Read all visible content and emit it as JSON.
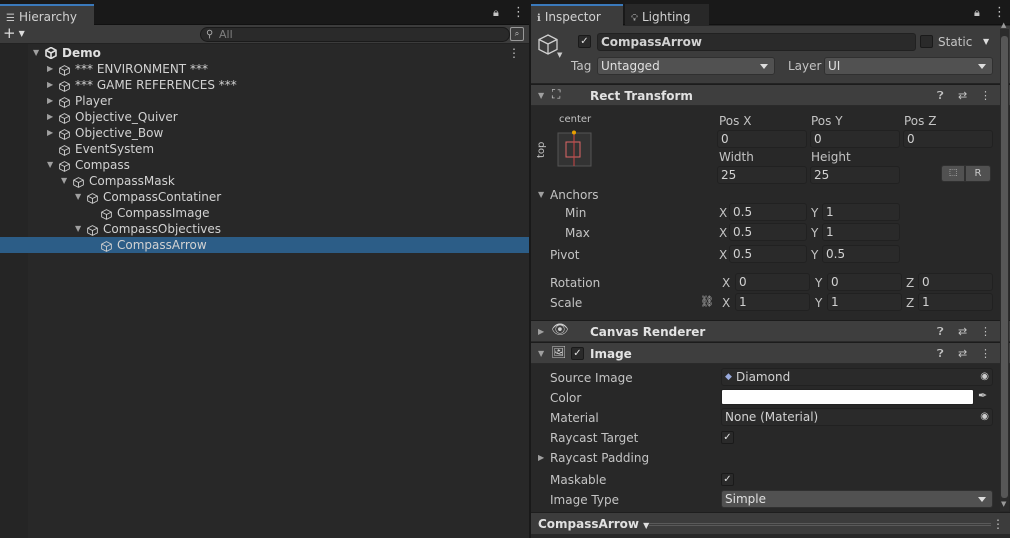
{
  "hierarchy": {
    "tab_label": "Hierarchy",
    "add_label": "+",
    "search_placeholder": "All",
    "scene": "Demo",
    "items": [
      {
        "label": "*** ENVIRONMENT ***",
        "depth": 1,
        "expandable": true,
        "expanded": false,
        "selected": false
      },
      {
        "label": "*** GAME REFERENCES ***",
        "depth": 1,
        "expandable": true,
        "expanded": false,
        "selected": false
      },
      {
        "label": "Player",
        "depth": 1,
        "expandable": true,
        "expanded": false,
        "selected": false
      },
      {
        "label": "Objective_Quiver",
        "depth": 1,
        "expandable": true,
        "expanded": false,
        "selected": false
      },
      {
        "label": "Objective_Bow",
        "depth": 1,
        "expandable": true,
        "expanded": false,
        "selected": false
      },
      {
        "label": "EventSystem",
        "depth": 1,
        "expandable": false,
        "expanded": false,
        "selected": false
      },
      {
        "label": "Compass",
        "depth": 1,
        "expandable": true,
        "expanded": true,
        "selected": false
      },
      {
        "label": "CompassMask",
        "depth": 2,
        "expandable": true,
        "expanded": true,
        "selected": false
      },
      {
        "label": "CompassContatiner",
        "depth": 3,
        "expandable": true,
        "expanded": true,
        "selected": false
      },
      {
        "label": "CompassImage",
        "depth": 4,
        "expandable": false,
        "expanded": false,
        "selected": false
      },
      {
        "label": "CompassObjectives",
        "depth": 3,
        "expandable": true,
        "expanded": true,
        "selected": false
      },
      {
        "label": "CompassArrow",
        "depth": 4,
        "expandable": false,
        "expanded": false,
        "selected": true
      }
    ]
  },
  "inspector": {
    "tabs": [
      {
        "label": "Inspector",
        "icon": "info-icon"
      },
      {
        "label": "Lighting",
        "icon": "bulb-icon"
      }
    ],
    "object_name": "CompassArrow",
    "static_label": "Static",
    "tag_label": "Tag",
    "tag_value": "Untagged",
    "layer_label": "Layer",
    "layer_value": "UI",
    "rect_transform": {
      "title": "Rect Transform",
      "anchor_preset_h": "center",
      "anchor_preset_v": "top",
      "pos_x_label": "Pos X",
      "pos_y_label": "Pos Y",
      "pos_z_label": "Pos Z",
      "pos_x": "0",
      "pos_y": "0",
      "pos_z": "0",
      "width_label": "Width",
      "height_label": "Height",
      "width": "25",
      "height": "25",
      "r_label": "R",
      "anchors_label": "Anchors",
      "min_label": "Min",
      "max_label": "Max",
      "min_x": "0.5",
      "min_y": "1",
      "max_x": "0.5",
      "max_y": "1",
      "pivot_label": "Pivot",
      "pivot_x": "0.5",
      "pivot_y": "0.5",
      "rotation_label": "Rotation",
      "rot_x": "0",
      "rot_y": "0",
      "rot_z": "0",
      "scale_label": "Scale",
      "scale_x": "1",
      "scale_y": "1",
      "scale_z": "1",
      "x": "X",
      "y": "Y",
      "z": "Z"
    },
    "canvas_renderer": {
      "title": "Canvas Renderer"
    },
    "image": {
      "title": "Image",
      "source_image_label": "Source Image",
      "source_image_value": "Diamond",
      "color_label": "Color",
      "color_value": "#ffffff",
      "material_label": "Material",
      "material_value": "None (Material)",
      "raycast_target_label": "Raycast Target",
      "raycast_padding_label": "Raycast Padding",
      "maskable_label": "Maskable",
      "image_type_label": "Image Type",
      "image_type_value": "Simple"
    },
    "footer_name": "CompassArrow"
  },
  "colors": {
    "selection": "#2c5d87",
    "tab_accent": "#3a79bb",
    "panel": "#282828"
  }
}
